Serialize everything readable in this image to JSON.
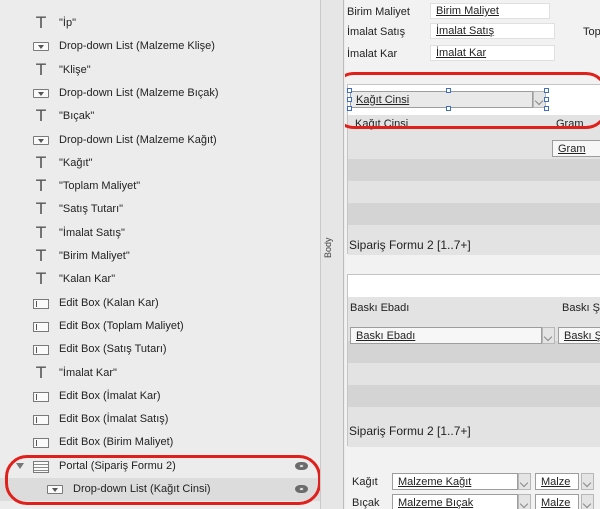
{
  "object_list": {
    "items": [
      {
        "type": "text",
        "label": "\"İp\""
      },
      {
        "type": "dropdown",
        "label": "Drop-down List (Malzeme Klişe)"
      },
      {
        "type": "text",
        "label": "\"Klişe\""
      },
      {
        "type": "dropdown",
        "label": "Drop-down List (Malzeme Bıçak)"
      },
      {
        "type": "text",
        "label": "\"Bıçak\""
      },
      {
        "type": "dropdown",
        "label": "Drop-down List (Malzeme Kağıt)"
      },
      {
        "type": "text",
        "label": "\"Kağıt\""
      },
      {
        "type": "text",
        "label": "\"Toplam Maliyet\""
      },
      {
        "type": "text",
        "label": "\"Satış Tutarı\""
      },
      {
        "type": "text",
        "label": "\"İmalat Satış\""
      },
      {
        "type": "text",
        "label": "\"Birim Maliyet\""
      },
      {
        "type": "text",
        "label": "\"Kalan Kar\""
      },
      {
        "type": "editbox",
        "label": "Edit Box (Kalan Kar)"
      },
      {
        "type": "editbox",
        "label": "Edit Box (Toplam Maliyet)"
      },
      {
        "type": "editbox",
        "label": "Edit Box (Satış Tutarı)"
      },
      {
        "type": "text",
        "label": "\"İmalat Kar\""
      },
      {
        "type": "editbox",
        "label": "Edit Box (İmalat Kar)"
      },
      {
        "type": "editbox",
        "label": "Edit Box (İmalat Satış)"
      },
      {
        "type": "editbox",
        "label": "Edit Box (Birim Maliyet)"
      },
      {
        "type": "portal",
        "label": "Portal (Sipariş Formu 2)"
      },
      {
        "type": "dropdown",
        "label": "Drop-down List (Kağıt Cinsi)"
      }
    ]
  },
  "body_label": "Body",
  "layout": {
    "fields": {
      "birim_maliyet_label": "Birim Maliyet",
      "birim_maliyet_value": "Birim Maliyet",
      "imalat_satis_label": "İmalat Satış",
      "imalat_satis_value": "İmalat Satış",
      "imalat_kar_label": "İmalat Kar",
      "imalat_kar_value": "İmalat Kar",
      "top_clipped": "Top"
    },
    "portal1": {
      "selected_field": "Kağıt Cinsi",
      "col1_header": "Kağıt Cinsi",
      "col2_header": "Gram",
      "col2_field": "Gram",
      "footer": "Sipariş Formu 2 [1..7+]"
    },
    "portal2": {
      "col1_header": "Baskı Ebadı",
      "col2_header": "Baskı Ş",
      "col1_field": "Baskı Ebadı",
      "col2_field": "Baskı Ş",
      "footer": "Sipariş Formu 2 [1..7+]"
    },
    "bottom_rows": {
      "kagit_label": "Kağıt",
      "kagit_field": "Malzeme Kağıt",
      "kagit_extra": "Malze",
      "bicak_label": "Bıçak",
      "bicak_field": "Malzeme Bıçak",
      "bicak_extra": "Malze"
    }
  },
  "colors": {
    "highlight_oval": "#e0201a",
    "selection_handles": "#3d6fc4"
  }
}
